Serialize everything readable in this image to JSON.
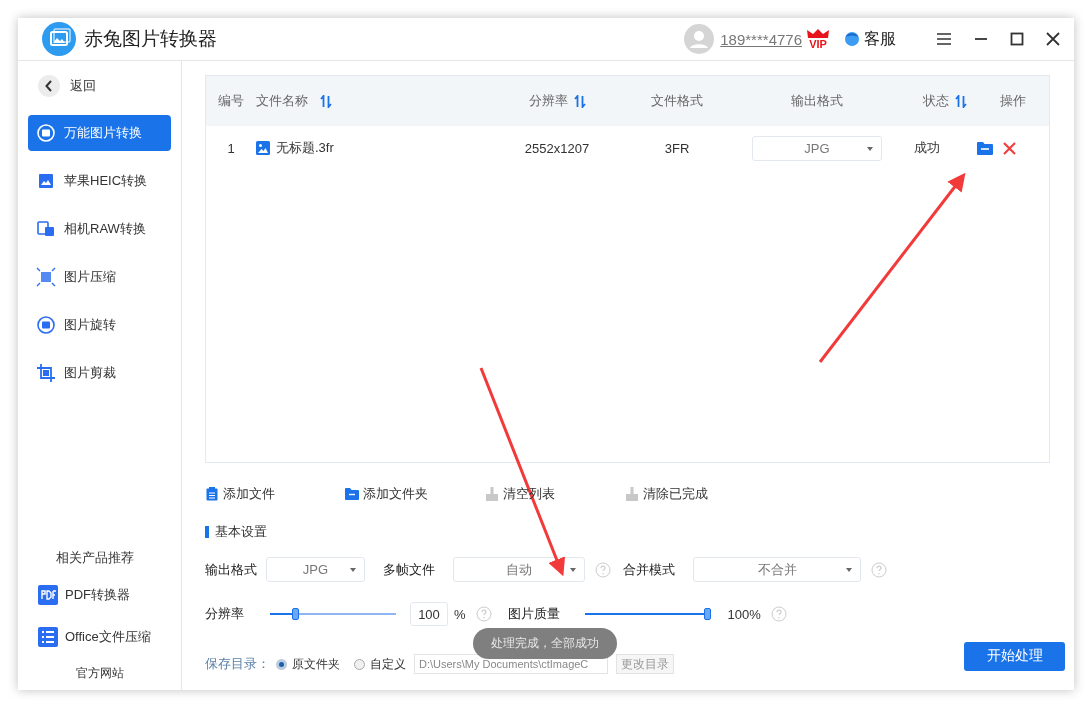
{
  "app": {
    "title": "赤兔图片转换器"
  },
  "account": {
    "phone": "189****4776",
    "vip_badge": "VIP"
  },
  "support": {
    "label": "客服"
  },
  "sidebar": {
    "back": "返回",
    "items": [
      {
        "label": "万能图片转换",
        "kind": "convert",
        "selected": true
      },
      {
        "label": "苹果HEIC转换",
        "kind": "heic",
        "selected": false
      },
      {
        "label": "相机RAW转换",
        "kind": "raw",
        "selected": false
      },
      {
        "label": "图片压缩",
        "kind": "compress",
        "selected": false
      },
      {
        "label": "图片旋转",
        "kind": "rotate",
        "selected": false
      },
      {
        "label": "图片剪裁",
        "kind": "crop",
        "selected": false
      }
    ],
    "related_heading": "相关产品推荐",
    "related": [
      {
        "label": "PDF转换器",
        "kind": "pdf"
      },
      {
        "label": "Office文件压缩",
        "kind": "office"
      }
    ],
    "website": "官方网站"
  },
  "table": {
    "columns": [
      {
        "label": "编号",
        "sortable": false
      },
      {
        "label": "文件名称",
        "sortable": true
      },
      {
        "label": "分辨率",
        "sortable": true
      },
      {
        "label": "文件格式",
        "sortable": false
      },
      {
        "label": "输出格式",
        "sortable": false
      },
      {
        "label": "状态",
        "sortable": true
      },
      {
        "label": "操作",
        "sortable": false
      }
    ],
    "rows": [
      {
        "index": "1",
        "name": "无标题.3fr",
        "resolution": "2552x1207",
        "file_format": "3FR",
        "output_format": "JPG",
        "status": "成功"
      }
    ]
  },
  "toolbar": [
    {
      "label": "添加文件",
      "kind": "add-file"
    },
    {
      "label": "添加文件夹",
      "kind": "add-folder"
    },
    {
      "label": "清空列表",
      "kind": "clear"
    },
    {
      "label": "清除已完成",
      "kind": "clear"
    }
  ],
  "settings": {
    "heading": "基本设置",
    "output_format": {
      "label": "输出格式",
      "value": "JPG"
    },
    "multi_frame": {
      "label": "多帧文件",
      "value": "自动"
    },
    "merge_mode": {
      "label": "合并模式",
      "value": "不合并"
    },
    "resolution": {
      "label": "分辨率",
      "level": 0.22,
      "value": "100",
      "unit": "%"
    },
    "quality": {
      "label": "图片质量",
      "level": 1.0,
      "reading": "100%"
    },
    "save_dir": {
      "label": "保存目录：",
      "options": [
        {
          "label": "原文件夹",
          "selected": true
        },
        {
          "label": "自定义",
          "selected": false
        }
      ],
      "path": "D:\\Users\\My Documents\\ctImageC",
      "change_button": "更改目录"
    }
  },
  "toast": "处理完成，全部成功",
  "start_button": "开始处理"
}
